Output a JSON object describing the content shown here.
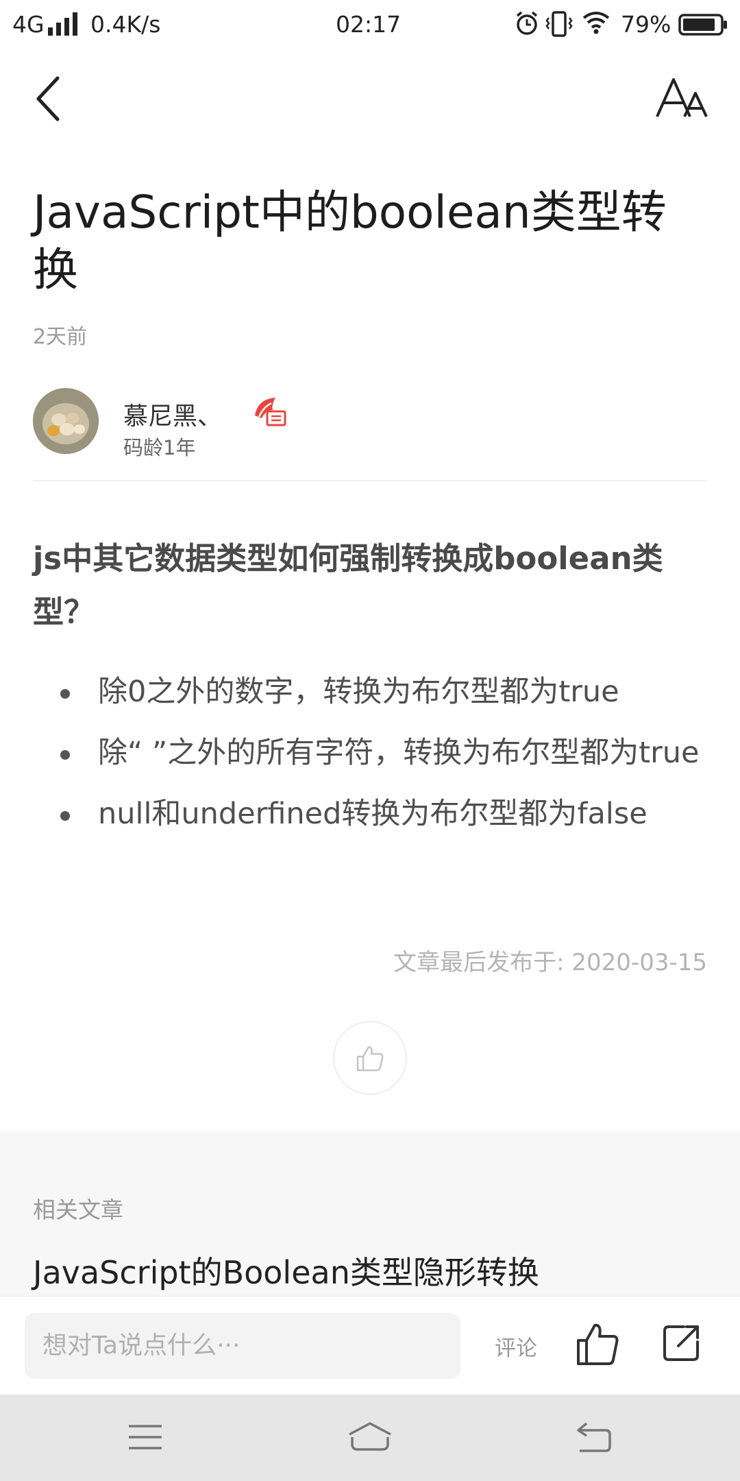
{
  "status_bar": {
    "network": "4G",
    "speed": "0.4K/s",
    "time": "02:17",
    "battery": "79%",
    "icons": [
      "signal-icon",
      "alarm-icon",
      "vibrate-icon",
      "wifi-icon",
      "battery-icon"
    ]
  },
  "header": {
    "back_icon": "chevron-left-icon",
    "font_icon": "font-size-icon"
  },
  "article": {
    "title": "JavaScript中的boolean类型转换",
    "time_ago": "2天前",
    "author": {
      "name": "慕尼黑、",
      "code_age": "码龄1年",
      "badge_icon": "author-badge-icon"
    },
    "subheading": "js中其它数据类型如何强制转换成boolean类型？",
    "bullets": [
      "除0之外的数字，转换为布尔型都为true",
      "除“ ”之外的所有字符，转换为布尔型都为true",
      "null和underfined转换为布尔型都为false"
    ],
    "publish_date": "文章最后发布于: 2020-03-15"
  },
  "related": {
    "label": "相关文章",
    "title": "JavaScript的Boolean类型隐形转换"
  },
  "comment_bar": {
    "placeholder": "想对Ta说点什么···",
    "comment_label": "评论"
  },
  "colors": {
    "text_primary": "#222222",
    "text_secondary": "#9a9a9a",
    "badge_red": "#e8453c",
    "nav_bg": "#e6e6e6"
  }
}
